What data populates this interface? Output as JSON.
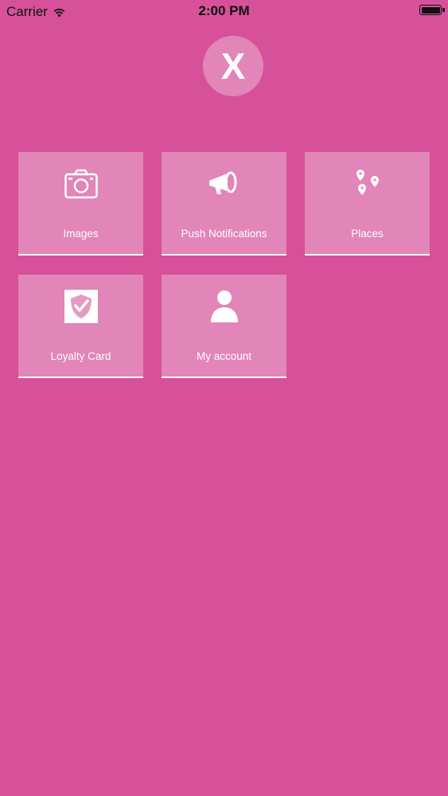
{
  "status_bar": {
    "carrier": "Carrier",
    "time": "2:00 PM",
    "wifi_icon": "wifi-icon",
    "battery_icon": "battery-icon"
  },
  "logo": {
    "letter": "X"
  },
  "tiles": [
    {
      "label": "Images",
      "icon": "camera-icon"
    },
    {
      "label": "Push Notifications",
      "icon": "megaphone-icon"
    },
    {
      "label": "Places",
      "icon": "map-pins-icon"
    },
    {
      "label": "Loyalty Card",
      "icon": "shield-check-icon"
    },
    {
      "label": "My account",
      "icon": "user-icon"
    }
  ],
  "colors": {
    "background": "#D6519A",
    "tile_overlay": "rgba(255,255,255,0.30)",
    "text": "#FFFFFF"
  }
}
